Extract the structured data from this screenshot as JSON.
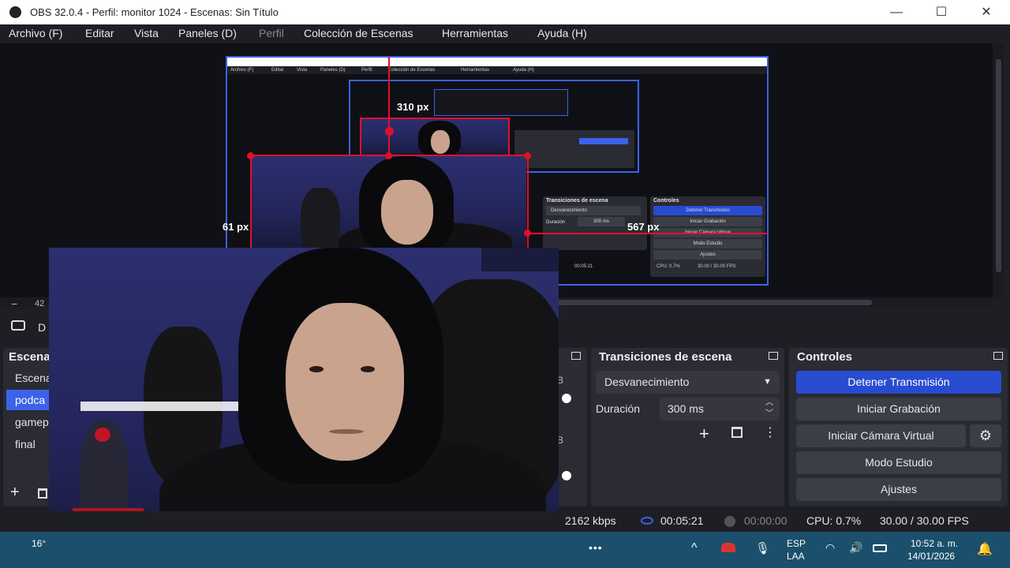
{
  "window": {
    "title": "OBS 32.0.4 - Perfil: monitor 1024 - Escenas: Sin Título",
    "minimize_glyph": "—",
    "maximize_glyph": "☐",
    "close_glyph": "✕"
  },
  "menu": {
    "archivo": "Archivo (F)",
    "editar": "Editar",
    "vista": "Vista",
    "paneles": "Paneles (D)",
    "perfil": "Perfil",
    "coleccion": "Colección de Escenas",
    "herramientas": "Herramientas",
    "ayuda": "Ayuda (H)"
  },
  "preview": {
    "measure_top": "310 px",
    "measure_left": "61 px",
    "measure_right": "567 px",
    "zoom_prefix": "42",
    "source_toolbar_label": "D"
  },
  "scenes": {
    "title": "Escena",
    "items": [
      "Escena",
      "podca",
      "gamep",
      "final"
    ],
    "selected_index": 1
  },
  "transitions": {
    "title": "Transiciones de escena",
    "selected": "Desvanecimiento",
    "duration_label": "Duración",
    "duration_value": "300 ms"
  },
  "controls": {
    "title": "Controles",
    "stop_stream": "Detener Transmisión",
    "start_recording": "Iniciar Grabación",
    "start_virtual_cam": "Iniciar Cámara Virtual",
    "studio_mode": "Modo Estudio",
    "settings": "Ajustes"
  },
  "status": {
    "bitrate": "2162 kbps",
    "stream_time": "00:05:21",
    "record_time": "00:00:00",
    "cpu": "CPU: 0.7%",
    "fps": "30.00 / 30.00 FPS"
  },
  "taskbar": {
    "weather": "16°",
    "language_top": "ESP",
    "language_bottom": "LAA",
    "time": "10:52 a. m.",
    "date": "14/01/2026",
    "more": "•••"
  },
  "nested_preview": {
    "menu": [
      "Archivo (F)",
      "Editar",
      "Vista",
      "Paneles (D)",
      "Perfil",
      "Colección de Escenas",
      "Herramientas",
      "Ayuda (H)"
    ],
    "transition_title": "Transiciones de escena",
    "transition_value": "Desvanecimiento",
    "duration_label": "Duración",
    "duration_value": "300 ms",
    "controls_title": "Controles",
    "controls": [
      "Detener Transmisión",
      "Iniciar Grabación",
      "Iniciar Cámara Virtual",
      "Modo Estudio",
      "Ajustes"
    ],
    "status": [
      "00:05:21",
      "CPU: 0.7%",
      "30.00 / 30.00 FPS"
    ]
  },
  "colors": {
    "accent": "#3b62e8",
    "bounding_box": "#e0102a",
    "panel": "#2a2b33",
    "background": "#1e1f25"
  }
}
